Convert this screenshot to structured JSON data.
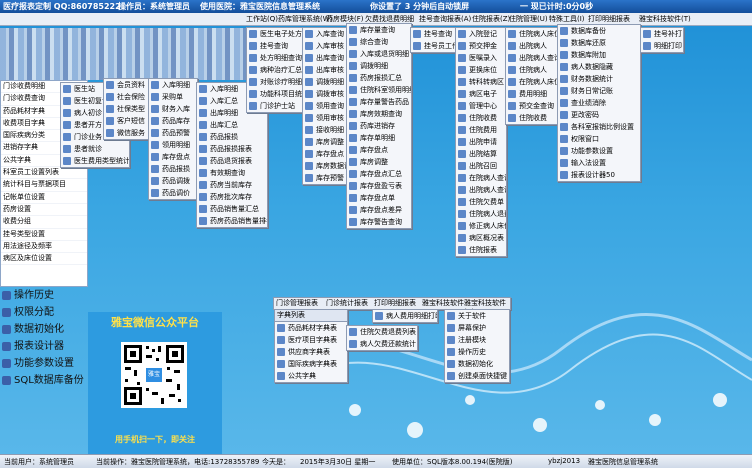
{
  "colors": {
    "title_bar": "#134e9a",
    "desktop": "#3aa6e2",
    "menu_bg": "#f4f6fa",
    "qr_caption": "#ffe14a"
  },
  "titlebar": {
    "title": "医疗报表定制 QQ:860785222",
    "operator": "操作员：系统管理员",
    "hospital": "使用医院：雅宝医院信息管理系统",
    "lock_notice": "你设置了 3 分钟后自动锁屏",
    "time": "一 现已计时:0分0秒"
  },
  "menubar": {
    "items": [
      "工作站(Q)",
      "药库管理系统(W)",
      "药房模块(F)",
      "欠费找退费明细",
      "挂号查询报表(A)",
      "住院报表(Z)",
      "住院管理(U)",
      "特殊工具(I)",
      "打印明细报表",
      "雅宝科技软件(T)"
    ]
  },
  "left_panel": {
    "rows": [
      "门诊收费明细",
      "门诊收费查询",
      "药品耗材字典",
      "收费项目字典",
      "国际疾病分类",
      "进销存字典",
      "公共字典",
      "科室员工设置列表",
      "统计科目与票据项目",
      "记帐单位设置",
      "药房设置",
      "收费分组",
      "挂号类型设置",
      "用法途径及频率",
      "病区及床位设置"
    ]
  },
  "left_bottom": {
    "items": [
      "操作历史",
      "权限分配",
      "数据初始化",
      "报表设计器",
      "功能参数设置",
      "SQL数据库备份"
    ]
  },
  "menus": {
    "work": [
      "医生站",
      "医生初复诊",
      "病人初诊",
      "患者开方",
      "门诊业务",
      "患者就诊",
      "医生费用类型统计"
    ],
    "ops": [
      "会员资料",
      "社会保险",
      "社保类型",
      "客户短信",
      "微信服务"
    ],
    "drug": [
      "入库明细",
      "采购单",
      "财务入库",
      "药品库存",
      "药品预警",
      "领用明细",
      "库存盘点",
      "药品报损",
      "药品调拨",
      "药品调价"
    ],
    "drug2": [
      "入库明细",
      "入库汇总",
      "出库明细",
      "出库汇总",
      "药品报损",
      "药品报损报表",
      "药品退货报表",
      "有效期查询",
      "药房当前库存",
      "药房批次库存",
      "药品销售量汇总",
      "药房药品销售量排名"
    ],
    "report1": [
      "医生电子处方",
      "挂号查询",
      "处方明细查询",
      "病种治疗汇总",
      "对账诊疗明细",
      "功能科项目统计",
      "门诊护士站"
    ],
    "report2": [
      "入库查询",
      "入库审核",
      "出库查询",
      "出库审核",
      "调拨明细",
      "调拨审核",
      "领用查询",
      "领用审核",
      "接收明细",
      "库房调整",
      "库存盘点",
      "库房数据调整",
      "库存预警"
    ],
    "stock": [
      "库存量查询",
      "综合查询",
      "入库或退货明细",
      "调拨明细",
      "药房报损汇总",
      "住院科室领用明细",
      "库存量警告药品",
      "库房效期查询",
      "药库进销存",
      "库存单明细",
      "库存盘点",
      "库房调整",
      "库存盘点汇总",
      "库存盘盈亏表",
      "库存盘点单",
      "库存盘点差异",
      "库存警告查询"
    ],
    "cash": [
      "挂号查询",
      "挂号员工作"
    ],
    "inpat": [
      "入院登记",
      "预交押金",
      "医嘱录入",
      "更换床位",
      "转科转病区",
      "病区电子",
      "管理中心",
      "住院收费",
      "住院费用",
      "出院申请",
      "出院结算",
      "出院召回",
      "在院病人查询",
      "出院病人查询",
      "住院欠费单",
      "住院病人退费",
      "修正病人床位",
      "病区概况表",
      "住院报表"
    ],
    "inpat2": [
      "住院病人床位",
      "出院病人",
      "出院病人查询",
      "住院病人",
      "在院病人床位",
      "费用明细",
      "预交金查询",
      "住院收费"
    ],
    "tools": [
      "数据库备份",
      "数据库还原",
      "数据库附加",
      "病人数据隐藏",
      "财务数据统计",
      "财务日常记账",
      "查业绩消除",
      "更改密码",
      "各科室报销比例设置",
      "权限窗口",
      "功能参数设置",
      "输入法设置",
      "报表设计器50"
    ],
    "extra": [
      "挂号补打",
      "明细打印"
    ],
    "dict": [
      "药品耗材字典表",
      "医疗项目字典表",
      "供应商字典表",
      "国际疾病字典表",
      "公共字典"
    ],
    "owe": [
      "住院欠费退费列表",
      "病人欠费还款统计"
    ],
    "print": [
      "病人费用明细打印"
    ],
    "about": [
      "关于软件",
      "屏幕保护",
      "注册模块",
      "操作历史",
      "数据初始化",
      "创建桌面快捷键"
    ]
  },
  "bottom_menubar": {
    "items": [
      "门诊管理报表",
      "门诊统计报表",
      "打印明细报表",
      "雅宝科技软件",
      "雅宝科技软件(B)"
    ]
  },
  "dict_header": "字典列表",
  "qr": {
    "title": "雅宝微信公众平台",
    "caption": "用手机扫一下，即关注",
    "logo": "雅宝"
  },
  "statusbar": {
    "user": "当前用户：系统管理员",
    "operation": "当前操作：雅宝医院管理系统，电话:13728355789",
    "today": "今天是：",
    "date": "2015年3月30日 星期一",
    "unit": "使用单位：SQL版本8.00.194(医院版)",
    "account": "ybzj2013",
    "product": "雅宝医院信息管理系统"
  }
}
